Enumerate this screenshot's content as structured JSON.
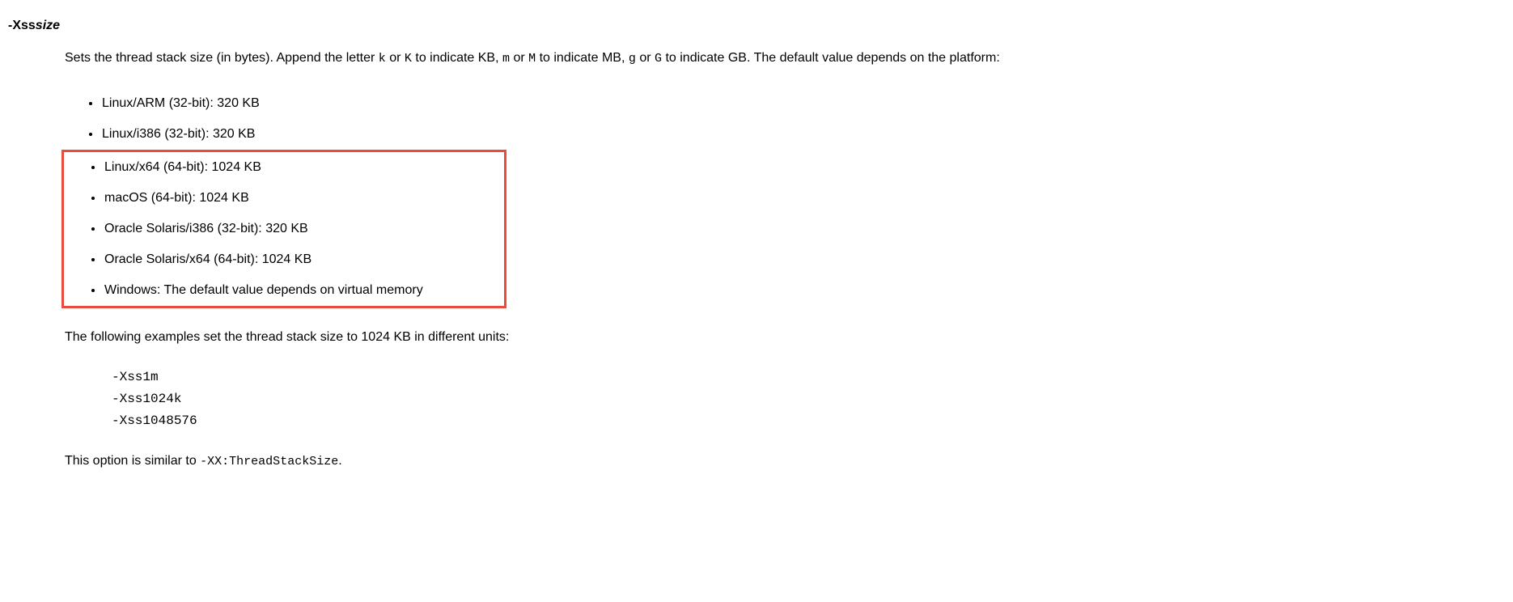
{
  "option": {
    "prefix": "-Xss",
    "param": "size"
  },
  "intro": {
    "part1": "Sets the thread stack size (in bytes). Append the letter ",
    "code1": "k",
    "part2": " or ",
    "code2": "K",
    "part3": " to indicate KB, ",
    "code3": "m",
    "part4": " or ",
    "code4": "M",
    "part5": " to indicate MB, ",
    "code5": "g",
    "part6": " or ",
    "code6": "G",
    "part7": " to indicate GB. The default value depends on the platform:"
  },
  "platforms_top": [
    "Linux/ARM (32-bit): 320 KB",
    "Linux/i386 (32-bit): 320 KB"
  ],
  "platforms_highlight": [
    "Linux/x64 (64-bit): 1024 KB",
    "macOS (64-bit): 1024 KB",
    "Oracle Solaris/i386 (32-bit): 320 KB",
    "Oracle Solaris/x64 (64-bit): 1024 KB",
    "Windows: The default value depends on virtual memory"
  ],
  "examples_intro": "The following examples set the thread stack size to 1024 KB in different units:",
  "code_block": "-Xss1m\n-Xss1024k\n-Xss1048576",
  "similar": {
    "part1": "This option is similar to ",
    "code1": "-XX:ThreadStackSize",
    "part2": "."
  }
}
